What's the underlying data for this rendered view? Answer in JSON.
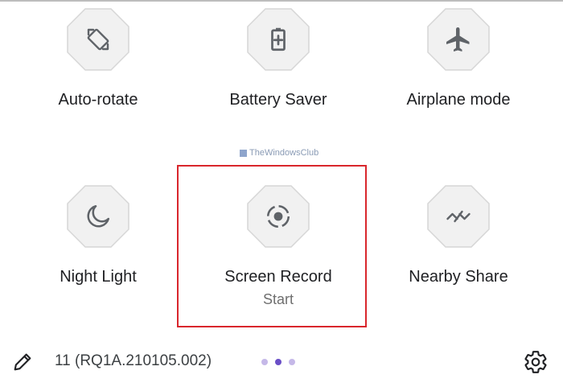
{
  "tiles": [
    {
      "label": "Auto-rotate",
      "icon": "rotate-icon"
    },
    {
      "label": "Battery Saver",
      "icon": "battery-saver-icon"
    },
    {
      "label": "Airplane mode",
      "icon": "airplane-icon"
    },
    {
      "label": "Night Light",
      "icon": "moon-icon"
    },
    {
      "label": "Screen Record",
      "sublabel": "Start",
      "icon": "screen-record-icon"
    },
    {
      "label": "Nearby Share",
      "icon": "nearby-share-icon"
    }
  ],
  "watermark": "TheWindowsClub",
  "footer": {
    "build_number": "11 (RQ1A.210105.002)",
    "page_count": 3,
    "active_page": 2
  },
  "colors": {
    "highlight": "#d9262c",
    "tile_bg": "#f1f1f1",
    "icon": "#5f6368",
    "dot_active": "#6a4fc7",
    "dot_inactive": "#c5b8e8"
  }
}
